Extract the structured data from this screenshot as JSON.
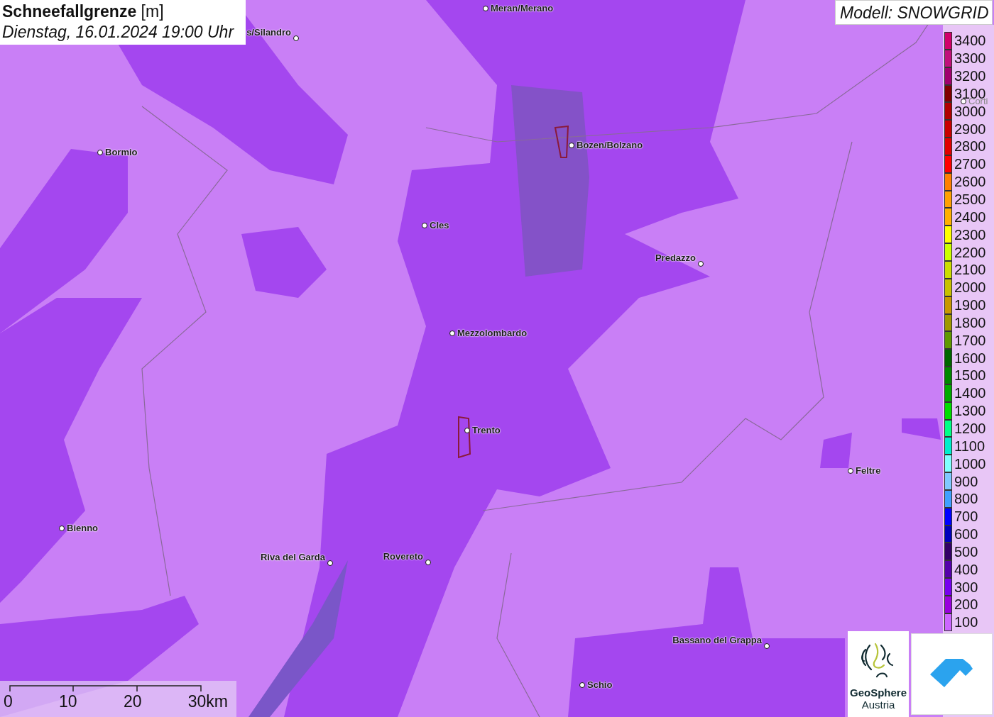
{
  "title": {
    "name": "Schneefallgrenze",
    "unit": "[m]",
    "datetime": "Dienstag, 16.01.2024 19:00 Uhr"
  },
  "model": "Modell: SNOWGRID",
  "places": [
    {
      "name": "Meran/Merano"
    },
    {
      "name": "s/Silandro"
    },
    {
      "name": "Bormio"
    },
    {
      "name": "Bozen/Bolzano"
    },
    {
      "name": "Cles"
    },
    {
      "name": "Predazzo"
    },
    {
      "name": "Mezzolombardo"
    },
    {
      "name": "Trento"
    },
    {
      "name": "Feltre"
    },
    {
      "name": "Bienno"
    },
    {
      "name": "Riva del Garda"
    },
    {
      "name": "Rovereto"
    },
    {
      "name": "Bassano del Grappa"
    },
    {
      "name": "Schio"
    },
    {
      "name": "Corti"
    }
  ],
  "legend": [
    {
      "label": "3400",
      "color": "#d0006a"
    },
    {
      "label": "3300",
      "color": "#c0107a"
    },
    {
      "label": "3200",
      "color": "#a0006e"
    },
    {
      "label": "3100",
      "color": "#800000"
    },
    {
      "label": "3000",
      "color": "#b00000"
    },
    {
      "label": "2900",
      "color": "#c80000"
    },
    {
      "label": "2800",
      "color": "#e00000"
    },
    {
      "label": "2700",
      "color": "#ff0000"
    },
    {
      "label": "2600",
      "color": "#ff8000"
    },
    {
      "label": "2500",
      "color": "#ffa000"
    },
    {
      "label": "2400",
      "color": "#ffb000"
    },
    {
      "label": "2300",
      "color": "#ffff00"
    },
    {
      "label": "2200",
      "color": "#ccff00"
    },
    {
      "label": "2100",
      "color": "#ccdd00"
    },
    {
      "label": "2000",
      "color": "#c8c000"
    },
    {
      "label": "1900",
      "color": "#c89800"
    },
    {
      "label": "1800",
      "color": "#a09800"
    },
    {
      "label": "1700",
      "color": "#609800"
    },
    {
      "label": "1600",
      "color": "#006600"
    },
    {
      "label": "1500",
      "color": "#008800"
    },
    {
      "label": "1400",
      "color": "#00aa00"
    },
    {
      "label": "1300",
      "color": "#00dd00"
    },
    {
      "label": "1200",
      "color": "#00ff88"
    },
    {
      "label": "1100",
      "color": "#00eecc"
    },
    {
      "label": "1000",
      "color": "#80ffff"
    },
    {
      "label": "900",
      "color": "#80c8ff"
    },
    {
      "label": "800",
      "color": "#40a0ff"
    },
    {
      "label": "700",
      "color": "#0000ff"
    },
    {
      "label": "600",
      "color": "#0000bb"
    },
    {
      "label": "500",
      "color": "#330066"
    },
    {
      "label": "400",
      "color": "#5500aa"
    },
    {
      "label": "300",
      "color": "#7700ee"
    },
    {
      "label": "200",
      "color": "#9900dd"
    },
    {
      "label": "100",
      "color": "#cc66ff"
    }
  ],
  "scale": {
    "ticks": [
      "0",
      "10",
      "20"
    ],
    "end": "30km"
  },
  "logo": {
    "line1": "GeoSphere",
    "line2": "Austria"
  }
}
